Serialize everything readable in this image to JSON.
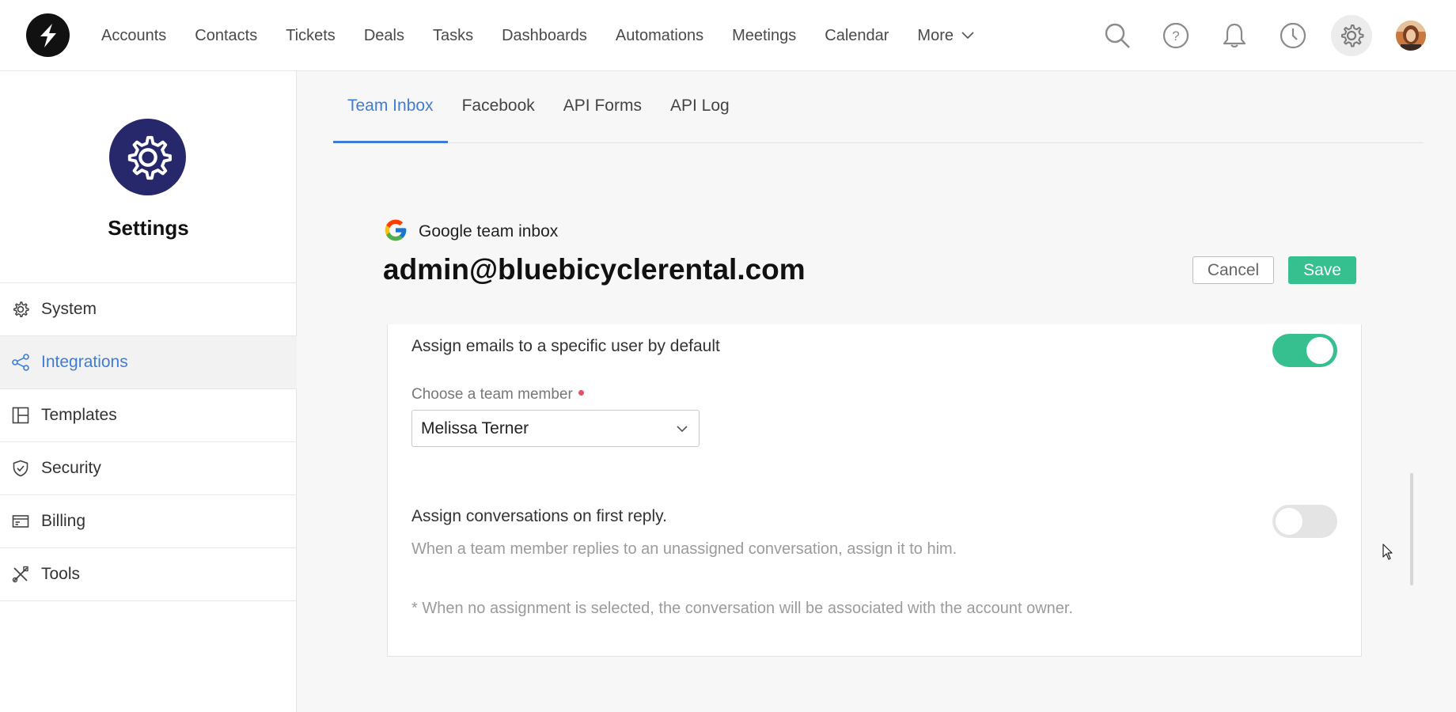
{
  "nav": {
    "items": [
      "Accounts",
      "Contacts",
      "Tickets",
      "Deals",
      "Tasks",
      "Dashboards",
      "Automations",
      "Meetings",
      "Calendar"
    ],
    "more_label": "More"
  },
  "top_icons": [
    "search-icon",
    "help-icon",
    "bell-icon",
    "clock-icon",
    "gear-icon"
  ],
  "sidebar": {
    "title": "Settings",
    "items": [
      {
        "label": "System",
        "icon": "gear-icon"
      },
      {
        "label": "Integrations",
        "icon": "share-icon"
      },
      {
        "label": "Templates",
        "icon": "layout-icon"
      },
      {
        "label": "Security",
        "icon": "shield-icon"
      },
      {
        "label": "Billing",
        "icon": "card-icon"
      },
      {
        "label": "Tools",
        "icon": "tools-icon"
      }
    ],
    "active": "Integrations"
  },
  "tabs": [
    "Team Inbox",
    "Facebook",
    "API Forms",
    "API Log"
  ],
  "active_tab": "Team Inbox",
  "inbox": {
    "type_label": "Google team inbox",
    "email": "admin@bluebicyclerental.com",
    "cancel_label": "Cancel",
    "save_label": "Save"
  },
  "assign_default": {
    "label": "Assign emails to a specific user by default",
    "enabled": true,
    "member_label": "Choose a team member",
    "member_value": "Melissa Terner"
  },
  "assign_first_reply": {
    "label": "Assign conversations on first reply.",
    "enabled": false,
    "description": "When a team member replies to an unassigned conversation, assign it to him."
  },
  "footnote": "* When no assignment is selected, the conversation will be associated with the account owner.",
  "colors": {
    "accent_blue": "#3f7cd9",
    "save_green": "#36c08f",
    "settings_badge": "#27286b"
  }
}
